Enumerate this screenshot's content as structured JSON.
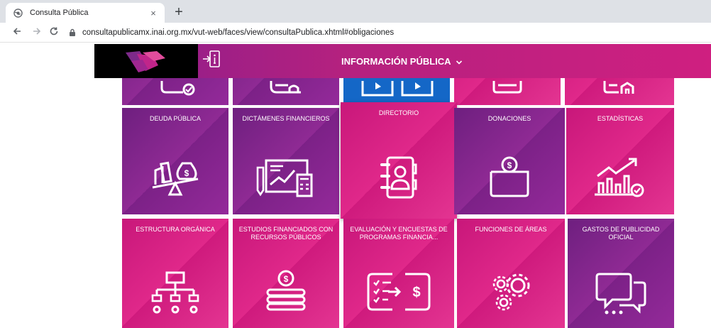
{
  "browser": {
    "tab_title": "Consulta Pública",
    "tab_close": "×",
    "new_tab": "+",
    "url": "consultapublicamx.inai.org.mx/vut-web/faces/view/consultaPublica.xhtml#obligaciones",
    "icons": {
      "back": "back-arrow-icon",
      "forward": "forward-arrow-icon",
      "reload": "reload-icon",
      "lock": "lock-icon",
      "favicon": "globe-icon"
    }
  },
  "header": {
    "menu_title": "INFORMACIÓN PÚBLICA",
    "colors": {
      "purple": "#8a1d8d",
      "pink": "#cf1f80"
    }
  },
  "tiles": {
    "row0": [
      {
        "icon": "document-check-icon",
        "label": ""
      },
      {
        "icon": "id-card-icon",
        "label": ""
      },
      {
        "icon": "video-screens-icon",
        "label": ""
      },
      {
        "icon": "screen-icon",
        "label": ""
      },
      {
        "icon": "building-icon",
        "label": ""
      }
    ],
    "row1": [
      {
        "label": "DEUDA PÚBLICA",
        "icon": "debt-scale-icon"
      },
      {
        "label": "DICTÁMENES FINANCIEROS",
        "icon": "financial-report-icon"
      },
      {
        "label": "DIRECTORIO",
        "icon": "address-book-icon"
      },
      {
        "label": "DONACIONES",
        "icon": "donation-box-icon"
      },
      {
        "label": "ESTADÍSTICAS",
        "icon": "statistics-chart-icon"
      }
    ],
    "row2": [
      {
        "label": "ESTRUCTURA ORGÁNICA",
        "icon": "org-chart-icon"
      },
      {
        "label": "ESTUDIOS FINANCIADOS CON RECURSOS PÚBLICOS",
        "icon": "coin-stack-icon"
      },
      {
        "label": "EVALUACIÓN Y ENCUESTAS DE PROGRAMAS FINANCIA...",
        "icon": "survey-money-icon"
      },
      {
        "label": "FUNCIONES DE ÁREAS",
        "icon": "gears-icon"
      },
      {
        "label": "GASTOS DE PUBLICIDAD OFICIAL",
        "icon": "chat-bubbles-icon"
      }
    ]
  }
}
